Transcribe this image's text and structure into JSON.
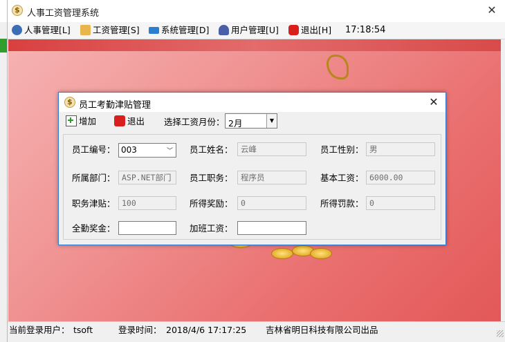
{
  "app": {
    "title": "人事工资管理系统"
  },
  "menu": [
    {
      "label": "人事管理[L]",
      "icon": "personnel-icon",
      "color": "#3a6fb5"
    },
    {
      "label": "工资管理[S]",
      "icon": "salary-icon",
      "color": "#c98a1a"
    },
    {
      "label": "系统管理[D]",
      "icon": "system-icon",
      "color": "#2a7fd0"
    },
    {
      "label": "用户管理[U]",
      "icon": "user-icon",
      "color": "#4a5fa8"
    },
    {
      "label": "退出[H]",
      "icon": "exit-icon",
      "color": "#d91e1e"
    }
  ],
  "clock": "17:18:54",
  "status": {
    "user_label": "当前登录用户：",
    "user_value": "tsoft",
    "login_label": "登录时间：",
    "login_value": "2018/4/6 17:17:25",
    "company": "吉林省明日科技有限公司出品"
  },
  "dialog": {
    "title": "员工考勤津贴管理",
    "toolbar": {
      "add_label": "增加",
      "exit_label": "退出",
      "month_label": "选择工资月份：",
      "month_value": "2月"
    },
    "fields": {
      "emp_id_label": "员工编号：",
      "emp_id_value": "003",
      "emp_name_label": "员工姓名：",
      "emp_name_value": "云峰",
      "gender_label": "员工性别：",
      "gender_value": "男",
      "dept_label": "所属部门：",
      "dept_value": "ASP.NET部门",
      "position_label": "员工职务：",
      "position_value": "程序员",
      "base_salary_label": "基本工资：",
      "base_salary_value": "6000.00",
      "allowance_label": "职务津贴：",
      "allowance_value": "100",
      "bonus_label": "所得奖励：",
      "bonus_value": "0",
      "penalty_label": "所得罚款：",
      "penalty_value": "0",
      "attendance_label": "全勤奖金：",
      "attendance_value": "",
      "overtime_label": "加班工资：",
      "overtime_value": ""
    }
  },
  "colors": {
    "accent": "#2d7ad6",
    "background_pink": "#f09393",
    "background_red": "#e35858"
  }
}
